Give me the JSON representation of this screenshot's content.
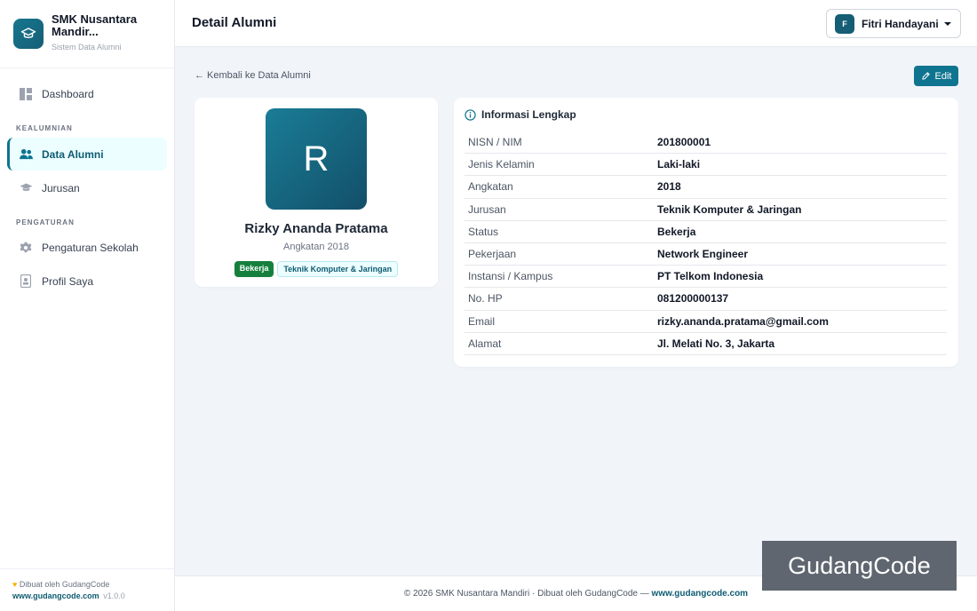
{
  "brand": {
    "name": "SMK Nusantara Mandir...",
    "subtitle": "Sistem Data Alumni",
    "logo_icon": "graduation-cap-icon"
  },
  "sidebar": {
    "items": [
      {
        "label": "Dashboard",
        "icon": "dashboard-icon"
      },
      {
        "label": "Data Alumni",
        "icon": "users-icon",
        "active": true
      },
      {
        "label": "Jurusan",
        "icon": "graduation-cap-icon"
      },
      {
        "label": "Pengaturan Sekolah",
        "icon": "gear-icon"
      },
      {
        "label": "Profil Saya",
        "icon": "id-badge-icon"
      }
    ],
    "sections": [
      "KEALUMNIAN",
      "PENGATURAN"
    ],
    "footer": {
      "made_by": "Dibuat oleh GudangCode",
      "url": "www.gudangcode.com",
      "version": "v1.0.0"
    }
  },
  "header": {
    "title": "Detail Alumni",
    "user": {
      "initial": "F",
      "name": "Fitri Handayani"
    }
  },
  "actions": {
    "back_label": "← Kembali ke Data Alumni",
    "edit_label": "Edit"
  },
  "profile": {
    "initial": "R",
    "name": "Rizky Ananda Pratama",
    "year_label": "Angkatan 2018",
    "status_badge": "Bekerja",
    "major_badge": "Teknik Komputer & Jaringan"
  },
  "info": {
    "title": "Informasi Lengkap",
    "rows": [
      {
        "label": "NISN / NIM",
        "value": "201800001"
      },
      {
        "label": "Jenis Kelamin",
        "value": "Laki-laki"
      },
      {
        "label": "Angkatan",
        "value": "2018"
      },
      {
        "label": "Jurusan",
        "value": "Teknik Komputer & Jaringan"
      },
      {
        "label": "Status",
        "value": "Bekerja"
      },
      {
        "label": "Pekerjaan",
        "value": "Network Engineer"
      },
      {
        "label": "Instansi / Kampus",
        "value": "PT Telkom Indonesia"
      },
      {
        "label": "No. HP",
        "value": "081200000137"
      },
      {
        "label": "Email",
        "value": "rizky.ananda.pratama@gmail.com"
      },
      {
        "label": "Alamat",
        "value": "Jl. Melati No. 3, Jakarta"
      }
    ]
  },
  "footer": {
    "text": "© 2026 SMK Nusantara Mandiri · Dibuat oleh GudangCode — ",
    "url": "www.gudangcode.com"
  },
  "watermark": "GudangCode",
  "colors": {
    "accent": "#0e7490",
    "status_green": "#15803d"
  }
}
